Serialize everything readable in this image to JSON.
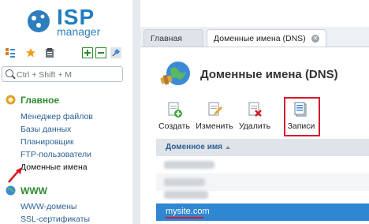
{
  "logo": {
    "brand": "ISP",
    "product": "manager"
  },
  "search": {
    "placeholder": "Ctrl + Shift + M"
  },
  "sidebar": {
    "sections": [
      {
        "title": "Главное",
        "items": [
          "Менеджер файлов",
          "Базы данных",
          "Планировщик",
          "FTP-пользователи",
          "Доменные имена"
        ]
      },
      {
        "title": "WWW",
        "items": [
          "WWW-домены",
          "SSL-сертификаты"
        ]
      }
    ]
  },
  "tabs": [
    {
      "label": "Главная"
    },
    {
      "label": "Доменные имена (DNS)"
    }
  ],
  "page": {
    "title": "Доменные имена (DNS)"
  },
  "toolbar": {
    "create": "Создать",
    "edit": "Изменить",
    "delete": "Удалить",
    "records": "Записи"
  },
  "table": {
    "header": "Доменное имя",
    "selected_row": "mysite.com"
  },
  "colors": {
    "accent": "#2f86d2",
    "highlight": "#d6192c",
    "section": "#2e8a2e"
  }
}
